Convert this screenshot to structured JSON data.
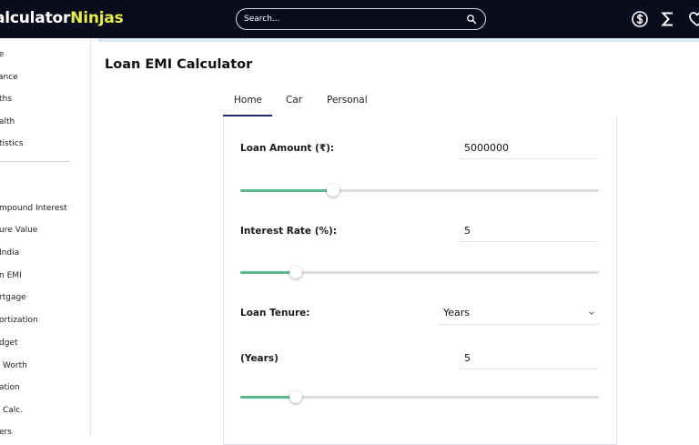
{
  "header": {
    "logo_main": "alculator",
    "logo_accent": "Ninjas",
    "search_placeholder": "Search...",
    "icons": [
      "search-icon",
      "dollar-icon",
      "sigma-icon",
      "heart-icon"
    ]
  },
  "sidebar": {
    "items_top": [
      "me",
      "ance",
      "ths",
      "alth",
      "tistics"
    ],
    "items_bottom": [
      "mpound Interest",
      "ure Value",
      "India",
      "n EMI",
      "rtgage",
      "ortization",
      "dget",
      "Worth",
      "ation",
      "Calc.",
      "ers"
    ]
  },
  "main": {
    "page_title": "Loan EMI Calculator",
    "tabs": [
      {
        "label": "Home",
        "active": true
      },
      {
        "label": "Car",
        "active": false
      },
      {
        "label": "Personal",
        "active": false
      }
    ],
    "loan_amount": {
      "label": "Loan Amount (₹):",
      "value": "5000000",
      "slider_fraction": 0.26
    },
    "interest_rate": {
      "label": "Interest Rate (%):",
      "value": "5",
      "slider_fraction": 0.155
    },
    "loan_tenure": {
      "label": "Loan Tenure:",
      "selected": "Years"
    },
    "years": {
      "label": "(Years)",
      "value": "5",
      "slider_fraction": 0.155
    }
  },
  "colors": {
    "header_bg": "#0b0b1e",
    "logo_accent": "#e6f04a",
    "slider_fill": "#5cb88f",
    "tab_active": "#1f2a6b"
  }
}
